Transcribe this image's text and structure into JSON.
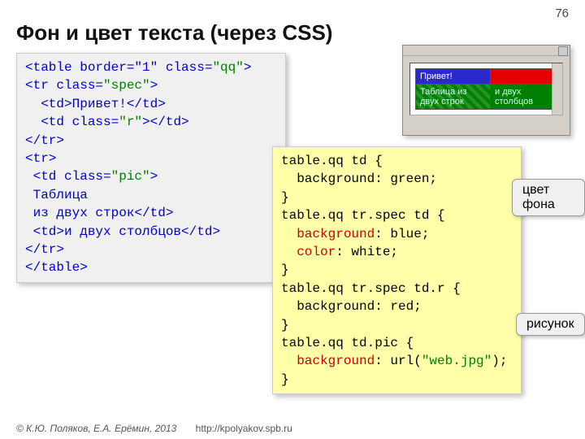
{
  "pageNumber": "76",
  "title": "Фон и цвет текста (через CSS)",
  "html_code": {
    "l1a": "<table ",
    "l1b": "border=\"1\"",
    "l1c": " class=",
    "l1d": "\"qq\"",
    "l1e": ">",
    "l2a": "<tr class=",
    "l2b": "\"spec\"",
    "l2c": ">",
    "l3": "  <td>Привет!</td>",
    "l4a": "  <td class=",
    "l4b": "\"r\"",
    "l4c": "></td>",
    "l5": "</tr>",
    "l6": "<tr>",
    "l7a": " <td class=",
    "l7b": "\"pic\"",
    "l7c": ">",
    "l8": " Таблица",
    "l9": " из двух строк</td>",
    "l10": " <td>и двух столбцов</td>",
    "l11": "</tr>",
    "l12": "</table>"
  },
  "css_code": {
    "l1": "table.qq td {",
    "l2": "  background: green;",
    "l3": "}",
    "l4": "table.qq tr.spec td {",
    "l5a": "  ",
    "l5b": "background",
    "l5c": ": blue;",
    "l6a": "  ",
    "l6b": "color",
    "l6c": ": white;",
    "l7": "}",
    "l8": "table.qq tr.spec td.r {",
    "l9": "  background: red;",
    "l10": "}",
    "l11": "table.qq td.pic {",
    "l12a": "  ",
    "l12b": "background",
    "l12c": ": url(",
    "l12d": "\"web.jpg\"",
    "l12e": ");",
    "l13": "}"
  },
  "demo": {
    "c1": "Привет!",
    "c2": "Таблица из двух строк",
    "c3": "и двух столбцов"
  },
  "callout1": "цвет фона",
  "callout2": "рисунок",
  "footer": {
    "authors": "© К.Ю. Поляков, Е.А. Ерёмин, 2013",
    "url": "http://kpolyakov.spb.ru"
  }
}
